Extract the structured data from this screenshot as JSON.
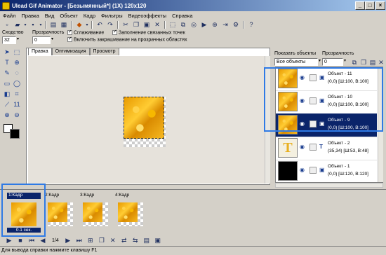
{
  "window": {
    "title": "Ulead Gif Animator - [Безымянный*] (1X) 120x120"
  },
  "menu": [
    "Файл",
    "Правка",
    "Вид",
    "Объект",
    "Кадр",
    "Фильтры",
    "Видеоэффекты",
    "Справка"
  ],
  "properties": {
    "similarity_label": "Сходство",
    "similarity_value": "32",
    "transparency_label": "Прозрачность",
    "transparency_value": "0",
    "smoothing_label": "Сглаживание",
    "fill_points_label": "Заполнение связанных точек",
    "transparent_fill_label": "Включить закрашивание на прозрачных областях"
  },
  "tabs": [
    "Правка",
    "Оптимизация",
    "Просмотр"
  ],
  "objects_panel": {
    "show_label": "Показать объекты",
    "show_value": "Все объекты",
    "transparency_label": "Прозрачность",
    "transparency_value": "0",
    "items": [
      {
        "name": "Объект - 11",
        "info": "(0,0) [Ш:100, В:100]",
        "type_icon": "image-icon",
        "thumb": "gold",
        "selected": false
      },
      {
        "name": "Объект - 10",
        "info": "(0,0) [Ш:100, В:100]",
        "type_icon": "image-icon",
        "thumb": "gold",
        "selected": false
      },
      {
        "name": "Объект - 9",
        "info": "(0,0) [Ш:100, В:100]",
        "type_icon": "image-icon",
        "thumb": "gold",
        "selected": true
      },
      {
        "name": "Объект - 2",
        "info": "(35,34) [Ш:53, В:48]",
        "type_icon": "text-icon",
        "thumb": "text",
        "selected": false
      },
      {
        "name": "Объект - 1",
        "info": "(0,0) [Ш:120, В:120]",
        "type_icon": "image-icon",
        "thumb": "black",
        "selected": false
      }
    ]
  },
  "frames": [
    {
      "label": "1:Кадр",
      "time": "0.1 сек.",
      "selected": true
    },
    {
      "label": "2:Кадр",
      "time": "",
      "selected": false
    },
    {
      "label": "3:Кадр",
      "time": "",
      "selected": false
    },
    {
      "label": "4:Кадр",
      "time": "",
      "selected": false
    }
  ],
  "frame_time": "0.1 сек.",
  "playback": {
    "counter": "1/4"
  },
  "status": "Для вывода справки нажмите клавишу F1",
  "colors": {
    "highlight": "#2f7ae5",
    "selection": "#0a246a",
    "titlebar": "#0a246a"
  }
}
